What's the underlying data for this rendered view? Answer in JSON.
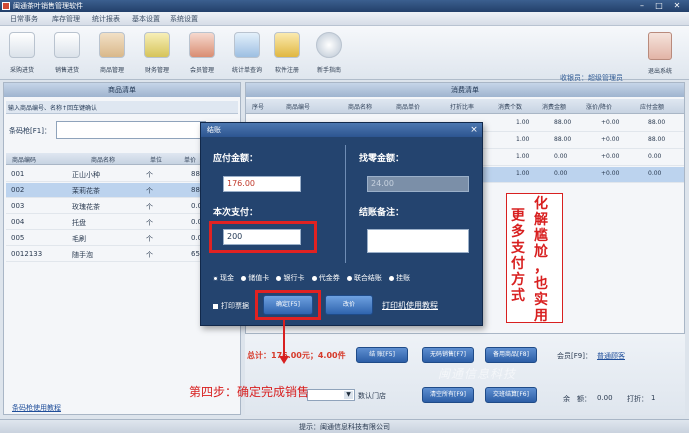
{
  "window": {
    "title": "闽通茶叶销售管理软件"
  },
  "menu": [
    "日常事务",
    "库存管理",
    "统计报表",
    "基本设置",
    "系统设置"
  ],
  "toolbar": [
    {
      "label": "采购进货",
      "icon": "document-icon"
    },
    {
      "label": "销售进货",
      "icon": "pen-icon"
    },
    {
      "label": "商品管理",
      "icon": "box-icon"
    },
    {
      "label": "财务管理",
      "icon": "money-icon"
    },
    {
      "label": "会员管理",
      "icon": "users-icon"
    },
    {
      "label": "统计单查询",
      "icon": "calculator-icon"
    },
    {
      "label": "软件注册",
      "icon": "key-icon"
    },
    {
      "label": "新手指南",
      "icon": "help-icon"
    }
  ],
  "cashier": {
    "label": "收银员：",
    "name": "超级管理员"
  },
  "exit": {
    "label": "退出系统"
  },
  "product_panel": {
    "title": "商品清单",
    "search_hint": "输入商品编号、名称↑回车键确认",
    "barcode_label": "条码枪[F1]：",
    "columns": [
      "商品编码",
      "商品名称",
      "单位",
      "单价"
    ],
    "rows": [
      {
        "code": "001",
        "name": "正山小种",
        "unit": "个",
        "price": "88.0"
      },
      {
        "code": "002",
        "name": "茉莉花茶",
        "unit": "个",
        "price": "88.0"
      },
      {
        "code": "003",
        "name": "玫瑰花茶",
        "unit": "个",
        "price": "0.0"
      },
      {
        "code": "004",
        "name": "托盘",
        "unit": "个",
        "price": "0.0"
      },
      {
        "code": "005",
        "name": "毛刷",
        "unit": "个",
        "price": "0.0"
      },
      {
        "code": "0012133",
        "name": "随手泡",
        "unit": "个",
        "price": "65.0"
      }
    ],
    "scan_link": "条码枪使用教程"
  },
  "consume_panel": {
    "title": "消费清单",
    "columns": [
      "序号",
      "商品编号",
      "商品名称",
      "商品单价",
      "打折比率",
      "消费个数",
      "消费金额",
      "涨价/降价",
      "应付金额"
    ],
    "rows": [
      {
        "qty": "1.00",
        "amount": "88.00",
        "adj": "+0.00",
        "due": "88.00"
      },
      {
        "qty": "1.00",
        "amount": "88.00",
        "adj": "+0.00",
        "due": "88.00"
      },
      {
        "qty": "1.00",
        "amount": "0.00",
        "adj": "+0.00",
        "due": "0.00"
      },
      {
        "qty": "1.00",
        "amount": "0.00",
        "adj": "+0.00",
        "due": "0.00"
      }
    ]
  },
  "bottom": {
    "total": "总计：176.00元；4.00件",
    "checkout_btn": "结 账[F5]",
    "nocode_btn": "无码销售[F7]",
    "spare_btn": "备用商品[F8]",
    "clear_btn": "清空所有[F9]",
    "change_btn": "交班结算[F6]",
    "member_label": "会员[F9]：",
    "member_value": "普通顾客",
    "balance_label": "余　额：",
    "balance_value": "0.00",
    "discount_label": "打折：",
    "discount_value": "1",
    "shop_label": "数认门店",
    "watermark": "闽通信息科技"
  },
  "status": {
    "text": "提示：闽通信息科技有限公司"
  },
  "dialog": {
    "title": "结账",
    "due_label": "应付金额：",
    "due_value": "176.00",
    "change_label": "找零金额：",
    "change_value": "24.00",
    "pay_label": "本次支付：",
    "pay_value": "200",
    "remark_label": "结账备注：",
    "payment_methods": [
      "现金",
      "储值卡",
      "银行卡",
      "代金券",
      "联合结账",
      "挂账"
    ],
    "print_label": "打印票据",
    "confirm_btn": "确定[F5]",
    "cancel_btn": "改价",
    "print_link": "打印机使用教程"
  },
  "annotations": {
    "col_left": "更多支付方式",
    "col_right": "化解尴尬，也实用",
    "step": "第四步：确定完成销售"
  },
  "colors": {
    "accent": "#2d5590",
    "alert": "#d82020",
    "total": "#d63a2a"
  }
}
